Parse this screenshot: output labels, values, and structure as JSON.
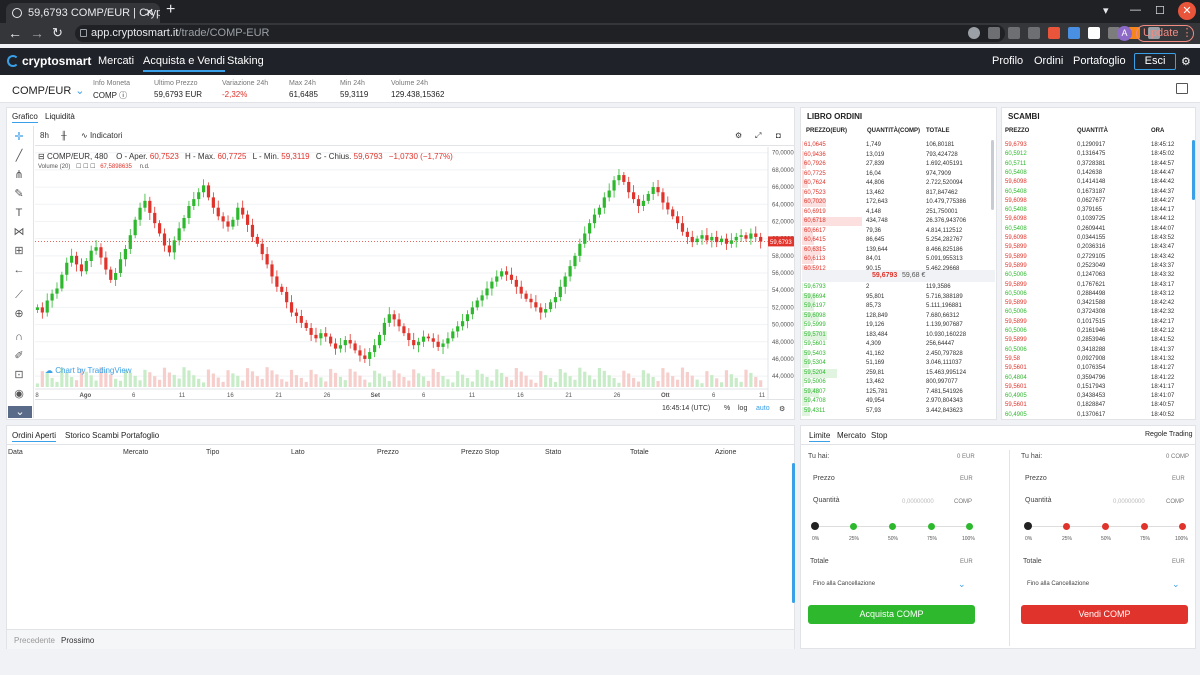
{
  "browser": {
    "tab_title": "59,6793 COMP/EUR | Cryp",
    "url_host": "app.cryptosmart.it",
    "url_path": "/trade/COMP-EUR",
    "update_label": "Update",
    "avatar_letter": "A"
  },
  "header": {
    "logo": "cryptosmart",
    "nav": [
      "Mercati",
      "Acquista e Vendi",
      "Staking"
    ],
    "right_nav": [
      "Profilo",
      "Ordini",
      "Portafoglio"
    ],
    "logout": "Esci"
  },
  "infobar": {
    "pair": "COMP/EUR",
    "items": [
      {
        "label": "Info Moneta",
        "value": "COMP ⓘ"
      },
      {
        "label": "Ultimo Prezzo",
        "value": "59,6793 EUR"
      },
      {
        "label": "Variazione 24h",
        "value": "-2,32%"
      },
      {
        "label": "Max 24h",
        "value": "61,6485"
      },
      {
        "label": "Min 24h",
        "value": "59,3119"
      },
      {
        "label": "Volume 24h",
        "value": "129.438,15362"
      }
    ]
  },
  "chart_panel": {
    "tabs": [
      "Grafico",
      "Liquidità"
    ],
    "interval": "8h",
    "indicators": "Indicatori",
    "legend_symbol": "COMP/EUR, 480",
    "legend_o_label": "O - Aper.",
    "legend_o": "60,7523",
    "legend_h_label": "H - Max.",
    "legend_h": "60,7725",
    "legend_l_label": "L - Min.",
    "legend_l": "59,3119",
    "legend_c_label": "C - Chius.",
    "legend_c": "59,6793",
    "legend_change": "−1,0730 (−1,77%)",
    "volume_label": "Volume (20)",
    "volume_value": "67,5898635",
    "volume_nd": "n.d.",
    "price_tag": "59,6793",
    "tradingview": "Chart by TradingView",
    "time": "16:45:14 (UTC)",
    "pct": "%",
    "log": "log",
    "auto": "auto"
  },
  "chart_data": {
    "type": "candlestick",
    "title": "COMP/EUR, 480",
    "y_ticks": [
      "70,0000",
      "68,0000",
      "66,0000",
      "64,0000",
      "62,0000",
      "60,0000",
      "58,0000",
      "56,0000",
      "54,0000",
      "52,0000",
      "50,0000",
      "48,0000",
      "46,0000",
      "44,0000"
    ],
    "ylim": [
      43.2,
      70.2
    ],
    "x_ticks": [
      "8",
      "Ago",
      "6",
      "11",
      "16",
      "21",
      "26",
      "Set",
      "6",
      "11",
      "16",
      "21",
      "26",
      "Ott",
      "6",
      "11"
    ],
    "last_price": 59.6793,
    "closes": [
      52.0,
      51.4,
      52.8,
      53.6,
      54.2,
      55.8,
      57.2,
      58.0,
      57.0,
      56.2,
      57.4,
      58.6,
      59.0,
      57.8,
      56.4,
      55.2,
      56.0,
      57.6,
      58.8,
      60.4,
      62.2,
      63.6,
      64.4,
      63.0,
      61.8,
      60.6,
      59.2,
      58.4,
      59.8,
      61.2,
      62.4,
      63.8,
      64.6,
      65.4,
      66.2,
      64.8,
      63.6,
      62.6,
      62.0,
      61.4,
      62.2,
      63.6,
      62.8,
      61.6,
      60.2,
      59.4,
      58.2,
      57.0,
      55.6,
      54.4,
      53.8,
      52.6,
      51.4,
      51.0,
      50.2,
      49.6,
      48.8,
      48.4,
      49.0,
      48.6,
      47.8,
      47.2,
      47.6,
      48.2,
      47.8,
      47.0,
      46.4,
      46.0,
      46.8,
      47.6,
      48.8,
      50.2,
      51.2,
      50.6,
      49.8,
      49.0,
      48.2,
      47.6,
      48.0,
      48.6,
      48.4,
      48.0,
      47.4,
      47.8,
      48.4,
      49.2,
      49.8,
      50.4,
      51.2,
      52.0,
      52.8,
      53.4,
      54.2,
      55.0,
      55.6,
      56.2,
      55.8,
      55.2,
      54.4,
      53.6,
      53.0,
      52.6,
      52.0,
      51.4,
      51.8,
      52.6,
      53.2,
      54.4,
      55.6,
      56.8,
      58.0,
      59.4,
      60.6,
      61.8,
      62.8,
      63.6,
      64.8,
      65.6,
      66.8,
      67.4,
      66.6,
      65.4,
      64.6,
      63.8,
      64.4,
      65.2,
      66.0,
      65.4,
      64.2,
      63.4,
      62.6,
      61.8,
      60.8,
      60.2,
      59.6,
      60.0,
      60.4,
      59.8,
      60.2,
      59.6,
      60.0,
      59.4,
      59.8,
      60.2,
      60.4,
      60.0,
      60.6,
      60.2,
      59.68
    ]
  },
  "order_book": {
    "title": "LIBRO ORDINI",
    "headers": [
      "PREZZO(EUR)",
      "QUANTITÀ(COMP)",
      "TOTALE"
    ],
    "asks": [
      [
        "61,0645",
        "1,749",
        "106,80181"
      ],
      [
        "60,9436",
        "13,019",
        "793,424728"
      ],
      [
        "60,7926",
        "27,839",
        "1.692,405191"
      ],
      [
        "60,7725",
        "16,04",
        "974,7909"
      ],
      [
        "60,7624",
        "44,806",
        "2.722,520094"
      ],
      [
        "60,7523",
        "13,462",
        "817,847462"
      ],
      [
        "60,7020",
        "172,643",
        "10.479,775386"
      ],
      [
        "60,6919",
        "4,148",
        "251,750001"
      ],
      [
        "60,6718",
        "434,748",
        "26.376,943706"
      ],
      [
        "60,6617",
        "79,36",
        "4.814,112512"
      ],
      [
        "60,6415",
        "86,645",
        "5.254,282767"
      ],
      [
        "60,6315",
        "139,644",
        "8.466,825186"
      ],
      [
        "60,6113",
        "84,01",
        "5.091,955313"
      ],
      [
        "60,5912",
        "90,15",
        "5.462,29668"
      ]
    ],
    "mid_price": "59,6793",
    "mid_eur": "59,68 €",
    "bids": [
      [
        "59,6793",
        "2",
        "119,3586"
      ],
      [
        "59,6694",
        "95,801",
        "5.716,388189"
      ],
      [
        "59,6197",
        "85,73",
        "5.111,196881"
      ],
      [
        "59,6098",
        "128,849",
        "7.680,66312"
      ],
      [
        "59,5999",
        "19,126",
        "1.139,907687"
      ],
      [
        "59,5701",
        "183,484",
        "10.930,160228"
      ],
      [
        "59,5601",
        "4,309",
        "256,64447"
      ],
      [
        "59,5403",
        "41,162",
        "2.450,797828"
      ],
      [
        "59,5304",
        "51,169",
        "3.046,111037"
      ],
      [
        "59,5204",
        "259,81",
        "15.463,995124"
      ],
      [
        "59,5006",
        "13,462",
        "800,997077"
      ],
      [
        "59,4807",
        "125,781",
        "7.481,541926"
      ],
      [
        "59,4708",
        "49,954",
        "2.970,804343"
      ],
      [
        "59,4311",
        "57,93",
        "3.442,843623"
      ]
    ]
  },
  "trades": {
    "title": "SCAMBI",
    "headers": [
      "PREZZO",
      "QUANTITÀ",
      "ORA"
    ],
    "rows": [
      [
        "59,6793",
        "0,1290917",
        "18:45:12",
        "r"
      ],
      [
        "60,5912",
        "0,1316475",
        "18:45:02",
        "g"
      ],
      [
        "60,5711",
        "0,3728381",
        "18:44:57",
        "g"
      ],
      [
        "60,5408",
        "0,142638",
        "18:44:47",
        "g"
      ],
      [
        "59,6098",
        "0,1414148",
        "18:44:42",
        "r"
      ],
      [
        "60,5408",
        "0,1673187",
        "18:44:37",
        "g"
      ],
      [
        "59,6098",
        "0,0627677",
        "18:44:27",
        "r"
      ],
      [
        "60,5408",
        "0,379165",
        "18:44:17",
        "g"
      ],
      [
        "59,6098",
        "0,1039725",
        "18:44:12",
        "r"
      ],
      [
        "60,5408",
        "0,2609441",
        "18:44:07",
        "g"
      ],
      [
        "59,6098",
        "0,0344155",
        "18:43:52",
        "r"
      ],
      [
        "59,5899",
        "0,2036316",
        "18:43:47",
        "r"
      ],
      [
        "59,5899",
        "0,2729105",
        "18:43:42",
        "r"
      ],
      [
        "59,5899",
        "0,2523049",
        "18:43:37",
        "r"
      ],
      [
        "60,5006",
        "0,1247063",
        "18:43:32",
        "g"
      ],
      [
        "59,5899",
        "0,1767621",
        "18:43:17",
        "r"
      ],
      [
        "60,5006",
        "0,2884498",
        "18:43:12",
        "g"
      ],
      [
        "59,5899",
        "0,3421588",
        "18:42:42",
        "r"
      ],
      [
        "60,5006",
        "0,3724308",
        "18:42:32",
        "g"
      ],
      [
        "59,5899",
        "0,1017515",
        "18:42:17",
        "r"
      ],
      [
        "60,5006",
        "0,2161946",
        "18:42:12",
        "g"
      ],
      [
        "59,5899",
        "0,2853946",
        "18:41:52",
        "r"
      ],
      [
        "60,5006",
        "0,3418288",
        "18:41:37",
        "g"
      ],
      [
        "59,58",
        "0,0927908",
        "18:41:32",
        "r"
      ],
      [
        "59,5601",
        "0,1076354",
        "18:41:27",
        "r"
      ],
      [
        "60,4804",
        "0,3594796",
        "18:41:22",
        "g"
      ],
      [
        "59,5601",
        "0,1517943",
        "18:41:17",
        "r"
      ],
      [
        "60,4905",
        "0,3438453",
        "18:41:07",
        "g"
      ],
      [
        "59,5601",
        "0,1828847",
        "18:40:57",
        "r"
      ],
      [
        "60,4905",
        "0,1370617",
        "18:40:52",
        "g"
      ]
    ]
  },
  "orders": {
    "tabs": [
      "Ordini Aperti",
      "Storico Scambi",
      "Portafoglio"
    ],
    "columns": [
      "Data",
      "Mercato",
      "Tipo",
      "Lato",
      "Prezzo",
      "Prezzo Stop",
      "Stato",
      "Totale",
      "Azione"
    ],
    "prev": "Precedente",
    "next": "Prossimo"
  },
  "trading": {
    "tabs": [
      "Limite",
      "Mercato",
      "Stop"
    ],
    "rules": "Regole Trading",
    "buy": {
      "have_label": "Tu hai:",
      "have_value": "0 EUR",
      "price_label": "Prezzo",
      "price_unit": "EUR",
      "qty_label": "Quantità",
      "qty_placeholder": "0,00000000",
      "qty_unit": "COMP",
      "total_label": "Totale",
      "total_unit": "EUR",
      "tif": "Fino alla Cancellazione",
      "button": "Acquista COMP",
      "color": "#2eb82e"
    },
    "sell": {
      "have_label": "Tu hai:",
      "have_value": "0 COMP",
      "price_label": "Prezzo",
      "price_unit": "EUR",
      "qty_label": "Quantità",
      "qty_placeholder": "0,00000000",
      "qty_unit": "COMP",
      "total_label": "Totale",
      "total_unit": "EUR",
      "tif": "Fino alla Cancellazione",
      "button": "Vendi COMP",
      "color": "#e0332b"
    },
    "pct_steps": [
      "0%",
      "25%",
      "50%",
      "75%",
      "100%"
    ]
  },
  "colors": {
    "accent": "#3aa0e8",
    "up": "#2eb82e",
    "down": "#e0332b"
  }
}
